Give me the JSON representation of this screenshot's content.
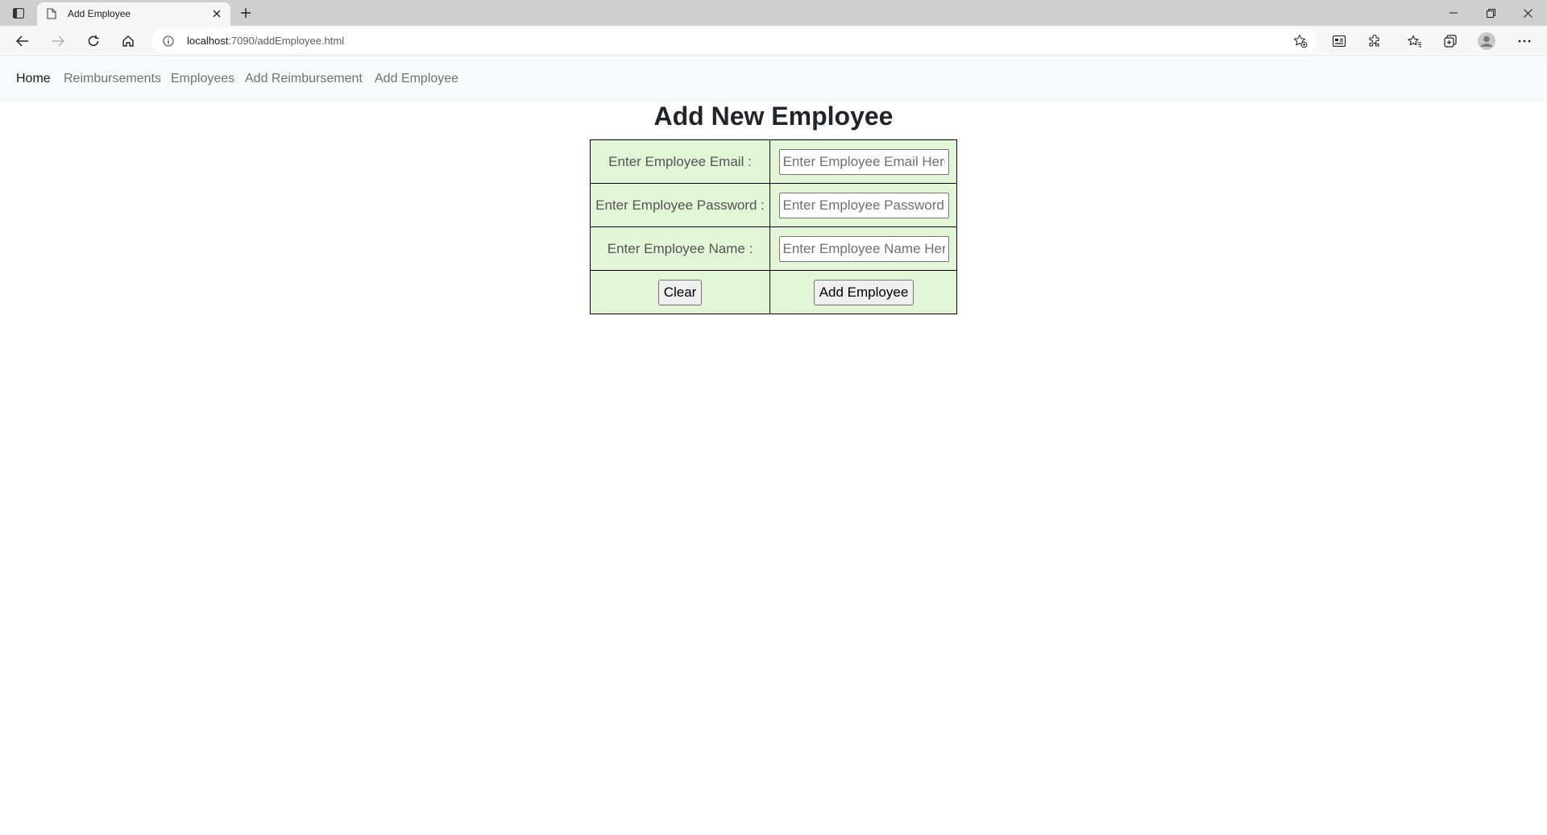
{
  "browser": {
    "tab_title": "Add Employee",
    "address_host": "localhost",
    "address_path": ":7090/addEmployee.html"
  },
  "navbar": {
    "items": [
      {
        "label": "Home",
        "active": true
      },
      {
        "label": "Reimbursements",
        "active": false
      },
      {
        "label": "Employees",
        "active": false
      },
      {
        "label": "Add Reimbursement",
        "active": false
      },
      {
        "label": "Add Employee",
        "active": false
      }
    ]
  },
  "page": {
    "title": "Add New Employee"
  },
  "form": {
    "email_label": "Enter Employee Email :",
    "email_placeholder": "Enter Employee Email Here",
    "email_value": "",
    "password_label": "Enter Employee Password :",
    "password_placeholder": "Enter Employee Password",
    "password_value": "",
    "name_label": "Enter Employee Name :",
    "name_placeholder": "Enter Employee Name Here",
    "name_value": "",
    "clear_button": "Clear",
    "submit_button": "Add Employee"
  },
  "colors": {
    "form_background": "#e2f5d6",
    "navbar_background": "#f8f9fa"
  }
}
